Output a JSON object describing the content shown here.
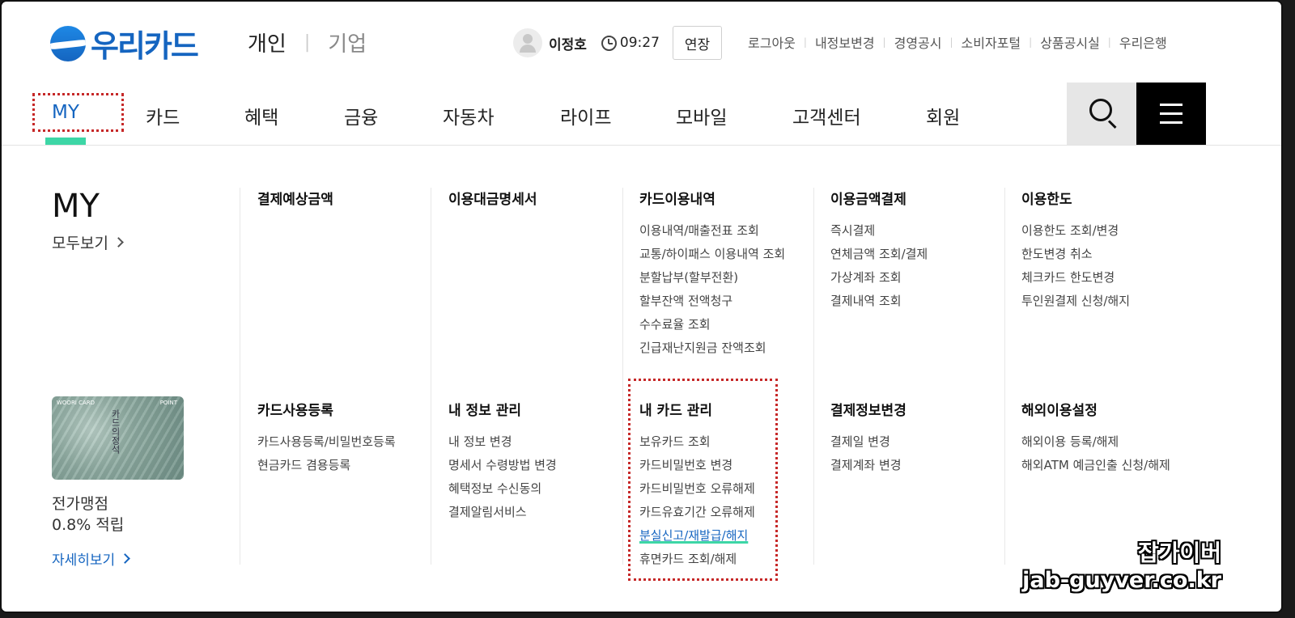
{
  "header": {
    "logo_text": "우리카드",
    "biz": {
      "personal": "개인",
      "corporate": "기업"
    },
    "user": {
      "name": "이정호",
      "time": "09:27",
      "extend_label": "연장"
    },
    "util_links": [
      "로그아웃",
      "내정보변경",
      "경영공시",
      "소비자포털",
      "상품공시실",
      "우리은행"
    ]
  },
  "gnb": {
    "items": [
      "MY",
      "카드",
      "혜택",
      "금융",
      "자동차",
      "라이프",
      "모바일",
      "고객센터",
      "회원"
    ],
    "search_icon": "search-icon",
    "menu_icon": "hamburger-icon",
    "accent": "#3dd6a6"
  },
  "mega": {
    "title": "MY",
    "view_all": "모두보기",
    "card": {
      "brand": "WOORI CARD",
      "point": "POINT",
      "name_on_card": "카드의정석",
      "desc1": "전가맹점",
      "desc2": "0.8% 적립",
      "more": "자세히보기"
    },
    "groups": [
      {
        "title": "결제예상금액",
        "items": []
      },
      {
        "title": "이용대금명세서",
        "items": []
      },
      {
        "title": "카드이용내역",
        "items": [
          "이용내역/매출전표 조회",
          "교통/하이패스 이용내역 조회",
          "분할납부(할부전환)",
          "할부잔액 전액청구",
          "수수료율 조회",
          "긴급재난지원금 잔액조회"
        ]
      },
      {
        "title": "이용금액결제",
        "items": [
          "즉시결제",
          "연체금액 조회/결제",
          "가상계좌 조회",
          "결제내역 조회"
        ]
      },
      {
        "title": "이용한도",
        "items": [
          "이용한도 조회/변경",
          "한도변경 취소",
          "체크카드 한도변경",
          "투인원결제 신청/해지"
        ]
      },
      {
        "title": "카드사용등록",
        "items": [
          "카드사용등록/비밀번호등록",
          "현금카드 겸용등록"
        ]
      },
      {
        "title": "내 정보 관리",
        "items": [
          "내 정보 변경",
          "명세서 수령방법 변경",
          "혜택정보 수신동의",
          "결제알림서비스"
        ]
      },
      {
        "title": "내 카드 관리",
        "items": [
          "보유카드 조회",
          "카드비밀번호 변경",
          "카드비밀번호 오류해제",
          "카드유효기간 오류해제",
          "분실신고/재발급/해지",
          "휴면카드 조회/해제"
        ]
      },
      {
        "title": "결제정보변경",
        "items": [
          "결제일 변경",
          "결제계좌 변경"
        ]
      },
      {
        "title": "해외이용설정",
        "items": [
          "해외이용 등록/해제",
          "해외ATM 예금인출 신청/해제"
        ]
      }
    ]
  },
  "watermark": {
    "line1": "잡가이버",
    "line2": "jab-guyver.co.kr"
  }
}
